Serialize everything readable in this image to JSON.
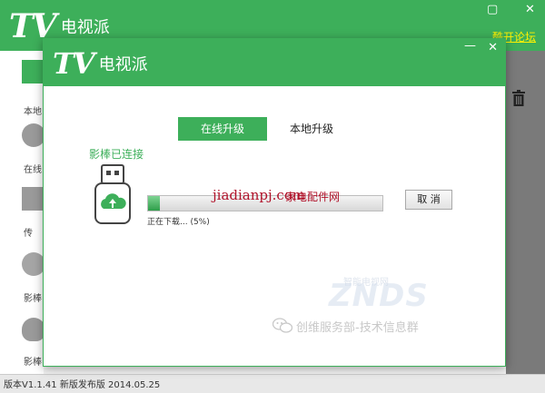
{
  "background_app": {
    "logo_mark": "TV",
    "app_name": "电视派",
    "minimize_glyph": "▢",
    "close_glyph": "✕",
    "forum_link": "酷开论坛",
    "sidebar": {
      "items": [
        {
          "label": "本地"
        },
        {
          "label": "在线"
        },
        {
          "label": "传"
        },
        {
          "label": "影棒"
        },
        {
          "label": "影棒"
        }
      ]
    },
    "status_bar": "版本V1.1.41 新版发布版 2014.05.25"
  },
  "dialog": {
    "logo_mark": "TV",
    "app_name": "电视派",
    "minimize_glyph": "—",
    "close_glyph": "✕",
    "tabs": [
      {
        "label": "在线升级",
        "active": true
      },
      {
        "label": "本地升级",
        "active": false
      }
    ],
    "device_status": "影棒已连接",
    "progress": {
      "percent": 5,
      "status_text": "正在下载... (5%)"
    },
    "cancel_label": "取 消"
  },
  "watermarks": {
    "site_latin": "jiadianpj.com",
    "site_cn": "家电配件网",
    "znds_sub": "智能电视网",
    "znds": "ZNDS",
    "wechat": "创维服务部-技术信息群"
  },
  "colors": {
    "brand_green": "#3daf5a",
    "forum_link": "#fff200",
    "watermark_red": "#b0122a"
  }
}
